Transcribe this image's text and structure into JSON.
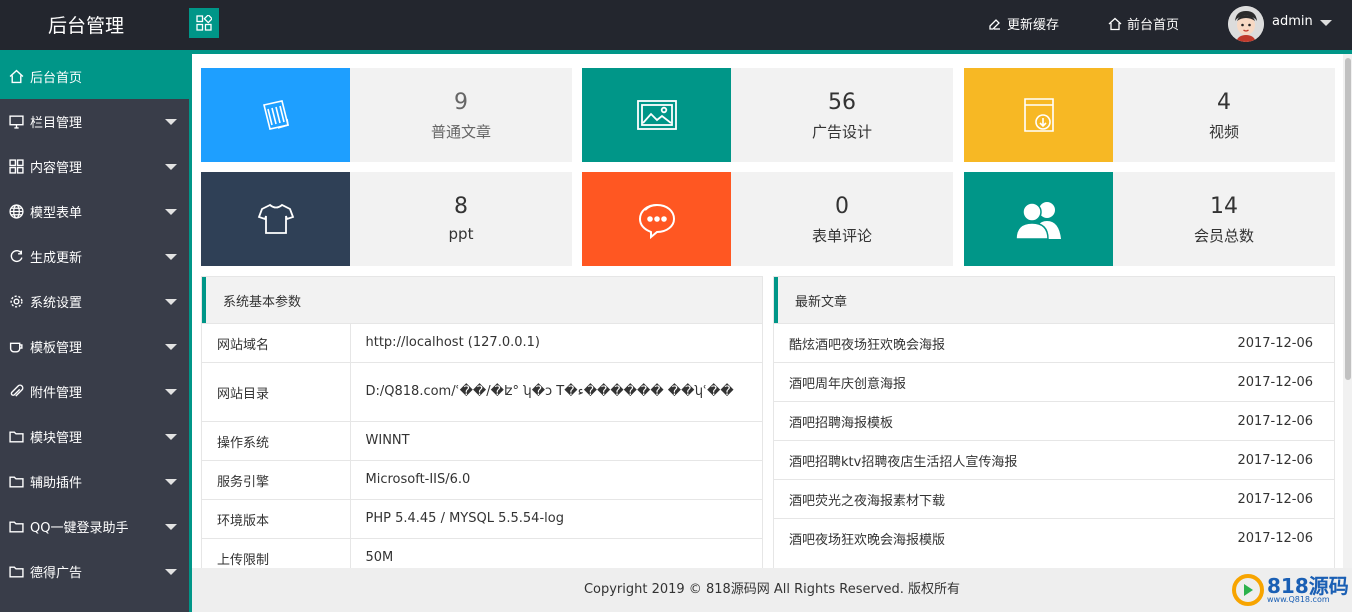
{
  "header": {
    "logo": "后台管理",
    "refresh_cache": "更新缓存",
    "front_home": "前台首页",
    "user": "admin"
  },
  "sidebar": {
    "items": [
      {
        "label": "后台首页",
        "icon": "home-icon"
      },
      {
        "label": "栏目管理",
        "icon": "monitor-icon"
      },
      {
        "label": "内容管理",
        "icon": "grid-icon"
      },
      {
        "label": "模型表单",
        "icon": "globe-icon"
      },
      {
        "label": "生成更新",
        "icon": "refresh-icon"
      },
      {
        "label": "系统设置",
        "icon": "gear-icon"
      },
      {
        "label": "模板管理",
        "icon": "cup-icon"
      },
      {
        "label": "附件管理",
        "icon": "paperclip-icon"
      },
      {
        "label": "模块管理",
        "icon": "folder-icon"
      },
      {
        "label": "辅助插件",
        "icon": "folder-icon"
      },
      {
        "label": "QQ一键登录助手",
        "icon": "folder-icon"
      },
      {
        "label": "德得广告",
        "icon": "folder-icon"
      }
    ]
  },
  "stats": [
    {
      "value": "9",
      "label": "普通文章",
      "color": "#1e9fff",
      "icon": "article-icon"
    },
    {
      "value": "56",
      "label": "广告设计",
      "color": "#009688",
      "icon": "image-icon"
    },
    {
      "value": "4",
      "label": "视频",
      "color": "#f7b824",
      "icon": "download-folder-icon"
    },
    {
      "value": "8",
      "label": "ppt",
      "color": "#2f4056",
      "icon": "shirt-icon"
    },
    {
      "value": "0",
      "label": "表单评论",
      "color": "#ff5722",
      "icon": "chat-icon"
    },
    {
      "value": "14",
      "label": "会员总数",
      "color": "#009688",
      "icon": "users-icon"
    }
  ],
  "system": {
    "title": "系统基本参数",
    "rows": [
      {
        "key": "网站域名",
        "value": "http://localhost (127.0.0.1)"
      },
      {
        "key": "网站目录",
        "value": "D:/Q818.com/ʿ��/�ʫ°              ʮ�ɔ       T�ء������ ��ʮʿ��"
      },
      {
        "key": "操作系统",
        "value": "WINNT"
      },
      {
        "key": "服务引擎",
        "value": "Microsoft-IIS/6.0"
      },
      {
        "key": "环境版本",
        "value": "PHP 5.4.45 / MYSQL 5.5.54-log"
      },
      {
        "key": "上传限制",
        "value": "50M"
      }
    ]
  },
  "articles": {
    "title": "最新文章",
    "items": [
      {
        "title": "酷炫酒吧夜场狂欢晚会海报",
        "date": "2017-12-06"
      },
      {
        "title": "酒吧周年庆创意海报",
        "date": "2017-12-06"
      },
      {
        "title": "酒吧招聘海报模板",
        "date": "2017-12-06"
      },
      {
        "title": "酒吧招聘ktv招聘夜店生活招人宣传海报",
        "date": "2017-12-06"
      },
      {
        "title": "酒吧荧光之夜海报素材下载",
        "date": "2017-12-06"
      },
      {
        "title": "酒吧夜场狂欢晚会海报模版",
        "date": "2017-12-06"
      }
    ]
  },
  "footer": {
    "text": "Copyright 2019 © 818源码网 All Rights Reserved. 版权所有"
  },
  "watermark": {
    "big": "818源码",
    "small": "www.Q818.com"
  }
}
